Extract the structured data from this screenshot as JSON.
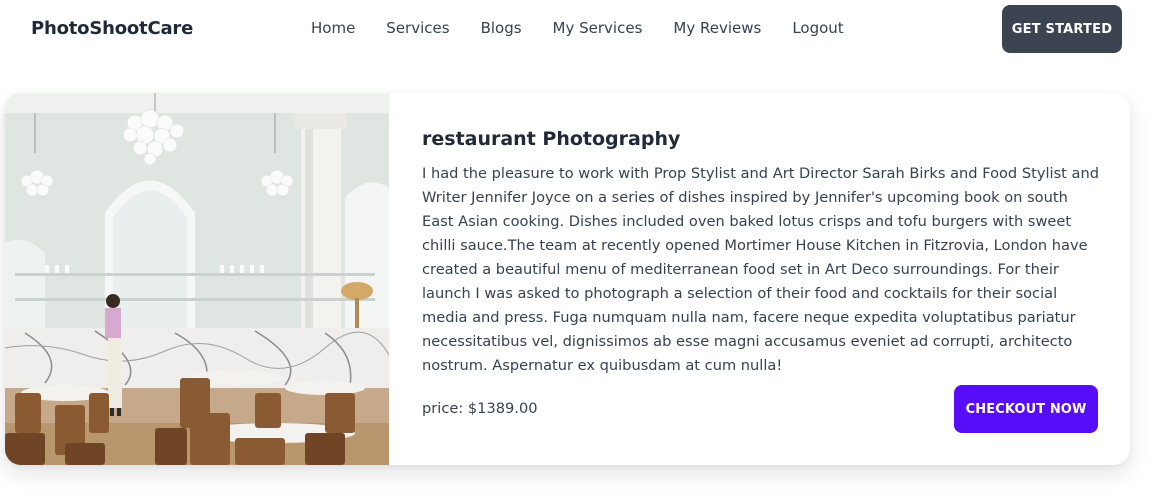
{
  "navbar": {
    "brand": "PhotoShootCare",
    "links": [
      "Home",
      "Services",
      "Blogs",
      "My Services",
      "My Reviews",
      "Logout"
    ],
    "cta_label": "GET STARTED"
  },
  "service": {
    "title": "restaurant Photography",
    "description": "I had the pleasure to work with Prop Stylist and Art Director Sarah Birks and Food Stylist and Writer Jennifer Joyce on a series of dishes inspired by Jennifer's upcoming book on south East Asian cooking. Dishes included oven baked lotus crisps and tofu burgers with sweet chilli sauce.The team at recently opened Mortimer House Kitchen in Fitzrovia, London have created a beautiful menu of mediterranean food set in Art Deco surroundings. For their launch I was asked to photograph a selection of their food and cocktails for their social media and press. Fuga numquam nulla nam, facere neque expedita voluptatibus pariatur necessitatibus vel, dignissimos ab esse magni accusamus eveniet ad corrupti, architecto nostrum. Aspernatur ex quibusdam at cum nulla!",
    "price": "price: $1389.00",
    "checkout_label": "CHECKOUT NOW"
  },
  "colors": {
    "cta_bg": "#3d4451",
    "checkout_bg": "#570df8"
  }
}
